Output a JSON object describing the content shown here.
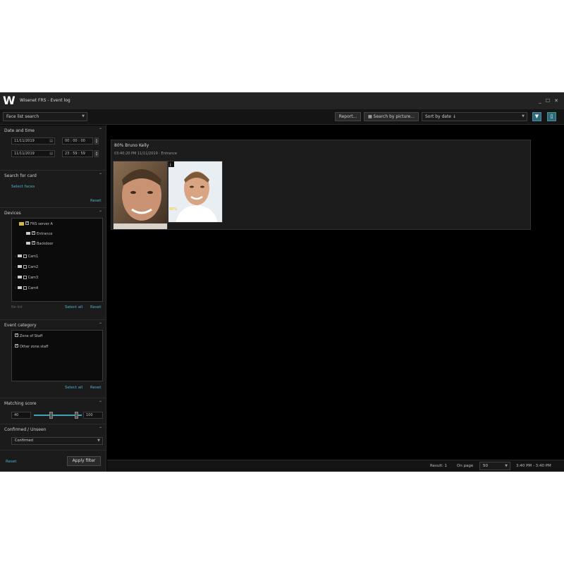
{
  "window": {
    "title": "Wisenet FRS - Event log",
    "logo": "W"
  },
  "toolbar": {
    "search_mode": "Face list search",
    "report_label": "Report...",
    "search_image_label": "Search by picture...",
    "sort_label": "Sort by date ↓",
    "icons": [
      "filter-icon",
      "panel-toggle-icon"
    ]
  },
  "sidebar": {
    "date_time": {
      "title": "Date and time",
      "from_date": "11/11/2019",
      "from_time": "00 : 00 : 00",
      "to_date": "11/11/2019",
      "to_time": "23 : 59 : 59"
    },
    "person": {
      "title": "Search for card",
      "select_link": "Select faces",
      "reset": "Reset"
    },
    "devices": {
      "title": "Devices",
      "tree": [
        {
          "label": "FRS server A",
          "type": "folder",
          "checked": true,
          "indent": 0
        },
        {
          "label": "Entrance",
          "type": "camera",
          "checked": true,
          "indent": 1
        },
        {
          "label": "Backdoor",
          "type": "camera",
          "checked": true,
          "indent": 1
        },
        {
          "label": "Cam1",
          "type": "camera",
          "checked": false,
          "indent": 0
        },
        {
          "label": "Cam2",
          "type": "camera",
          "checked": false,
          "indent": 0
        },
        {
          "label": "Cam3",
          "type": "camera",
          "checked": false,
          "indent": 0
        },
        {
          "label": "Cam4",
          "type": "camera",
          "checked": false,
          "indent": 0
        }
      ],
      "count_label": "No list",
      "select_all": "Select all",
      "reset": "Reset"
    },
    "event_category": {
      "title": "Event category",
      "items": [
        {
          "label": "Zone of Staff",
          "checked": true
        },
        {
          "label": "Other zone staff",
          "checked": true
        }
      ],
      "select_all": "Select all",
      "reset": "Reset"
    },
    "matching": {
      "title": "Matching score",
      "min": "40",
      "max": "100"
    },
    "confirm": {
      "title": "Confirmed / Unseen",
      "value": "Confirmed"
    },
    "footer": {
      "reset": "Reset",
      "apply": "Apply filter"
    }
  },
  "results": {
    "card": {
      "title": "80% Bruno Kelly",
      "meta": "03:40:20 PM  11/11/2019  ·  Entrance",
      "badge": "80%"
    }
  },
  "statusbar": {
    "result_label": "Result: 1",
    "per_page_label": "On page",
    "per_page": "50",
    "range": "3:40 PM - 3:40 PM"
  }
}
